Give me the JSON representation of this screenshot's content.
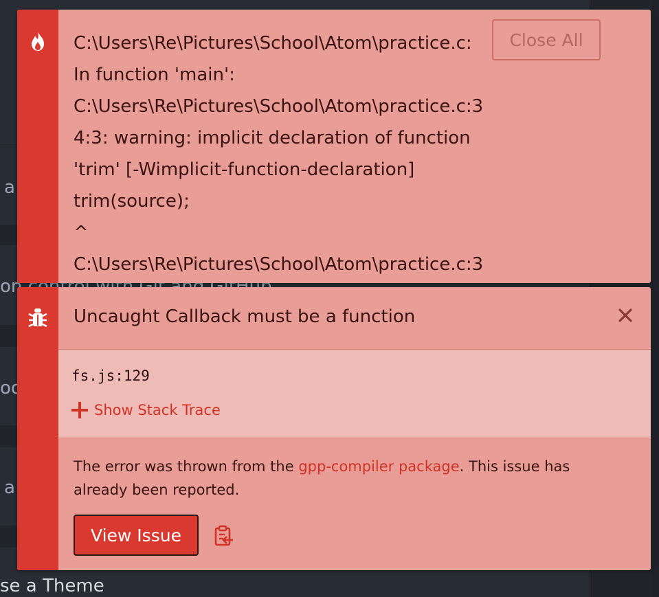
{
  "background": {
    "snippets": [
      "a",
      "on control with Git and GitHub",
      "oo",
      "a",
      "se a Theme"
    ]
  },
  "notification_warning": {
    "icon": "flame-icon",
    "lines": [
      "C:\\Users\\Re\\Pictures\\School\\Atom\\practice.c:",
      "In function 'main':",
      "C:\\Users\\Re\\Pictures\\School\\Atom\\practice.c:3",
      "4:3: warning: implicit declaration of function",
      "'trim' [-Wimplicit-function-declaration]",
      "trim(source);",
      "^",
      "C:\\Users\\Re\\Pictures\\School\\Atom\\practice.c:3"
    ],
    "close_all_label": "Close All"
  },
  "notification_error": {
    "icon": "bug-icon",
    "title": "Uncaught Callback must be a function",
    "location": "fs.js:129",
    "stack_trace_label": "Show Stack Trace",
    "desc_prefix": "The error was thrown from the ",
    "package_link": "gpp-compiler package",
    "desc_suffix": ". This issue has already been reported.",
    "view_issue_label": "View Issue",
    "copy_icon": "clipboard-copy-icon"
  },
  "colors": {
    "notification_bg": "#e89d96",
    "stripe": "#d9392e",
    "detail_bg": "#efbbb6",
    "link": "#d03226",
    "editor_bg": "#282c34"
  }
}
